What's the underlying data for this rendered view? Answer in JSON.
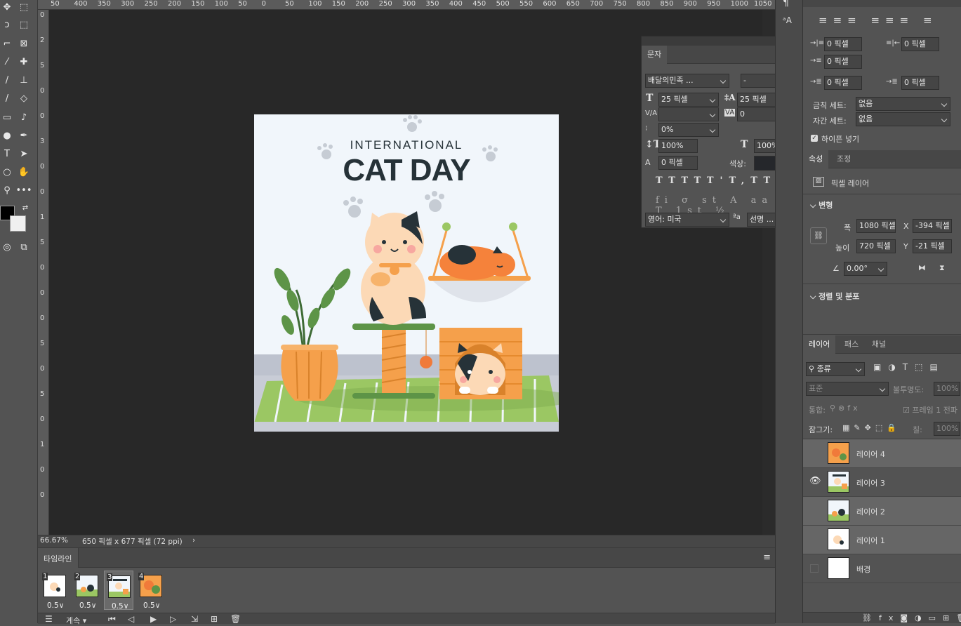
{
  "ruler_top": [
    "50",
    "400",
    "350",
    "300",
    "250",
    "200",
    "150",
    "100",
    "50",
    "0",
    "50",
    "100",
    "150",
    "200",
    "250",
    "300",
    "350",
    "400",
    "450",
    "500",
    "550",
    "600",
    "650",
    "700",
    "750",
    "800",
    "850",
    "900",
    "950",
    "1000",
    "1050"
  ],
  "ruler_left": [
    "0",
    "2",
    "5",
    "0",
    "0",
    "3",
    "0",
    "0",
    "1",
    "5",
    "0",
    "0",
    "0",
    "5",
    "0",
    "5",
    "0",
    "1",
    "0",
    "0"
  ],
  "canvas": {
    "title_small": "INTERNATIONAL",
    "title_big": "CAT DAY",
    "colors": {
      "bg": "#f1f6fb",
      "dark": "#263238",
      "orange": "#f5a04b",
      "green": "#9bc763"
    }
  },
  "status": {
    "zoom": "66.67%",
    "doc_info": "650 픽셀 x 677 픽셀 (72 ppi)"
  },
  "timeline": {
    "tab": "타임라인",
    "frames": [
      {
        "num": "1",
        "duration": "0.5"
      },
      {
        "num": "2",
        "duration": "0.5"
      },
      {
        "num": "3",
        "duration": "0.5"
      },
      {
        "num": "4",
        "duration": "0.5"
      }
    ],
    "loop": "계속"
  },
  "character": {
    "tab": "문자",
    "font_family": "배달의민족 ...",
    "font_style": "-",
    "font_size": "25 픽셀",
    "leading": "25 픽셀",
    "kerning": "",
    "tracking": "0",
    "tsume": "0%",
    "vscale": "100%",
    "hscale": "100%",
    "baseline": "0 픽셀",
    "color_label": "색상:",
    "language": "영어: 미국",
    "antialias": "선명 ...",
    "color_swatch": "#25272b"
  },
  "paragraph": {
    "indent_left": "0 픽셀",
    "indent_right": "0 픽셀",
    "indent_first": "0 픽셀",
    "space_before": "0 픽셀",
    "space_after": "0 픽셀",
    "kinsoku_label": "금칙 세트:",
    "kinsoku_value": "없음",
    "mojikumi_label": "자간 세트:",
    "mojikumi_value": "없음",
    "hyphenate": "하이픈 넣기"
  },
  "properties": {
    "tab_props": "속성",
    "tab_adjust": "조정",
    "layer_type": "픽셀 레이어",
    "transform_header": "변형",
    "w_label": "폭",
    "w_value": "1080 픽셀",
    "x_label": "X",
    "x_value": "-394 픽셀",
    "h_label": "높이",
    "h_value": "720 픽셀",
    "y_label": "Y",
    "y_value": "-21 픽셀",
    "angle": "0.00°",
    "align_header": "정렬 및 분포"
  },
  "layers": {
    "tabs": [
      "레이어",
      "패스",
      "채널"
    ],
    "filter": "종류",
    "blend": "표준",
    "opacity_label": "불투명도:",
    "opacity": "100%",
    "unify_label": "통합:",
    "propagate": "프레임 1 전파",
    "lock_label": "잠그기:",
    "fill_label": "칠:",
    "fill": "100%",
    "items": [
      {
        "name": "레이어 4",
        "visible": false
      },
      {
        "name": "레이어 3",
        "visible": true
      },
      {
        "name": "레이어 2",
        "visible": false
      },
      {
        "name": "레이어 1",
        "visible": false
      },
      {
        "name": "배경",
        "visible": false
      }
    ]
  },
  "colors": {
    "foreground": "#000000",
    "background": "#f0f0f0"
  }
}
